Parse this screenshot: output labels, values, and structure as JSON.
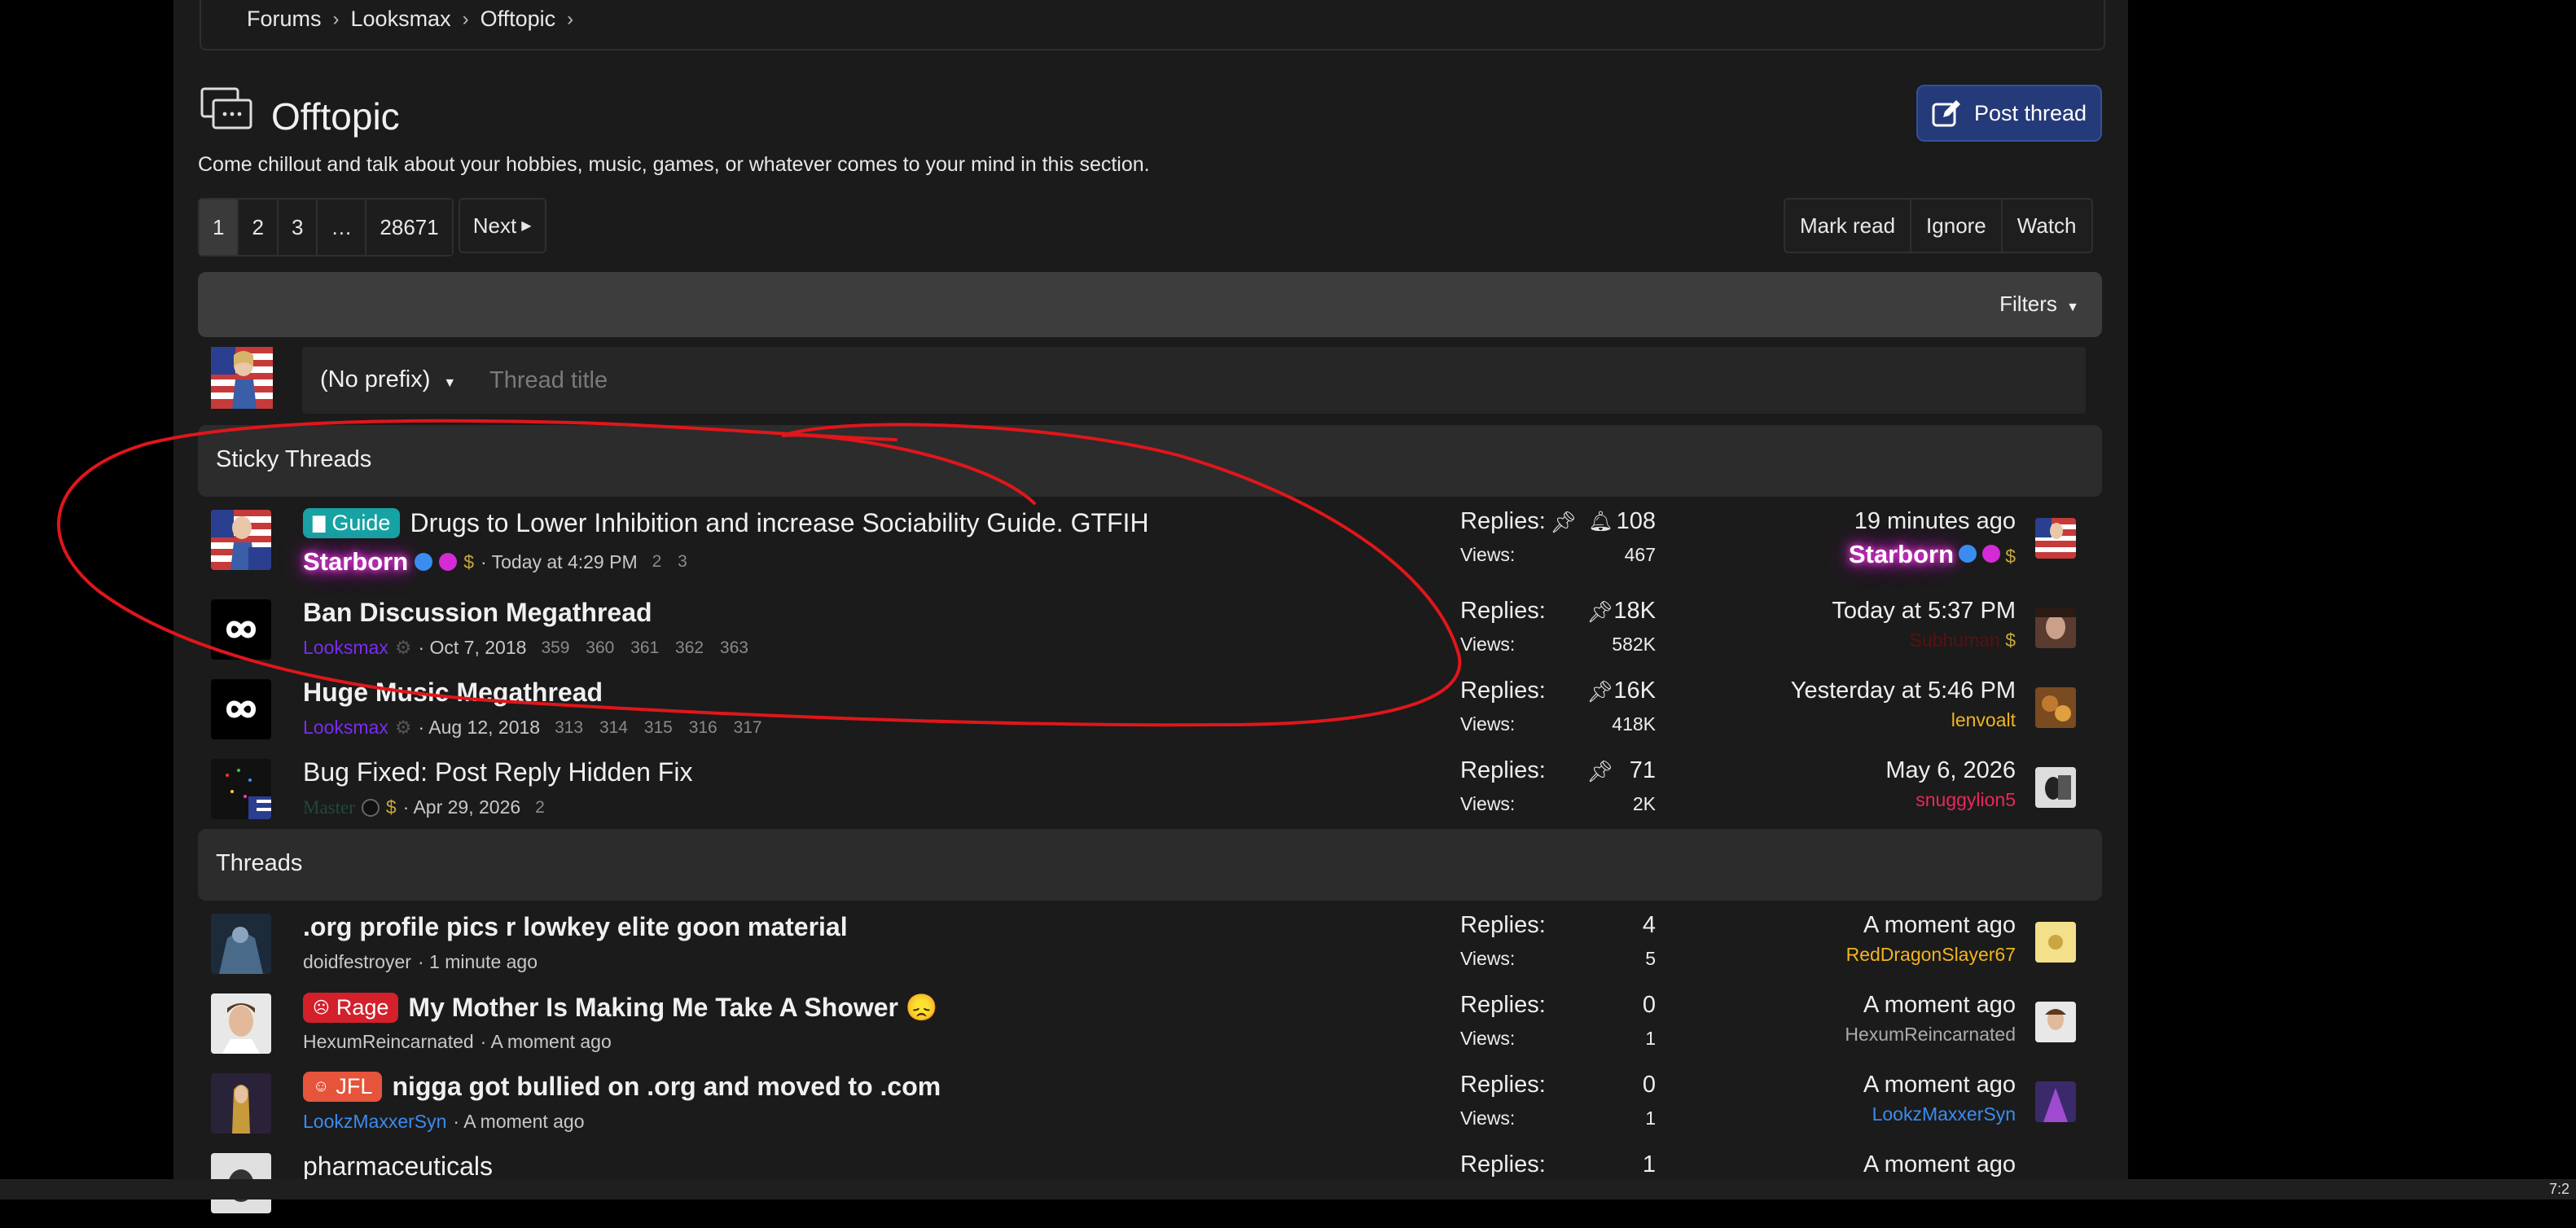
{
  "breadcrumb": [
    "Forums",
    "Looksmax",
    "Offtopic"
  ],
  "page": {
    "title": "Offtopic",
    "description": "Come chillout and talk about your hobbies, music, games, or whatever comes to your mind in this section.",
    "post_button": "Post thread"
  },
  "pagination": {
    "pages": [
      "1",
      "2",
      "3",
      "…",
      "28671"
    ],
    "current": "1",
    "next": "Next"
  },
  "actions": [
    "Mark read",
    "Ignore",
    "Watch"
  ],
  "filters_label": "Filters",
  "new_thread": {
    "prefix": "(No prefix)",
    "placeholder": "Thread title"
  },
  "sections": {
    "sticky": "Sticky Threads",
    "threads": "Threads"
  },
  "sticky_threads": [
    {
      "label": "Guide",
      "title": "Drugs to Lower Inhibition and increase Sociability Guide. GTFIH",
      "author": "Starborn",
      "date": "Today at 4:29 PM",
      "pages": "2 3",
      "replies": "108",
      "views": "467",
      "last_time": "19 minutes ago",
      "last_user": "Starborn"
    },
    {
      "title": "Ban Discussion Megathread",
      "author": "Looksmax",
      "date": "Oct 7, 2018",
      "pages": "359 360 361 362 363",
      "replies": "18K",
      "views": "582K",
      "last_time": "Today at 5:37 PM",
      "last_user": "Subhuman"
    },
    {
      "title": "Huge Music Megathread",
      "author": "Looksmax",
      "date": "Aug 12, 2018",
      "pages": "313 314 315 316 317",
      "replies": "16K",
      "views": "418K",
      "last_time": "Yesterday at 5:46 PM",
      "last_user": "lenvoalt"
    },
    {
      "title": "Bug Fixed: Post Reply Hidden Fix",
      "author": "Master",
      "date": "Apr 29, 2026",
      "pages": "2",
      "replies": "71",
      "views": "2K",
      "last_time": "May 6, 2026",
      "last_user": "snuggylion5"
    }
  ],
  "threads": [
    {
      "title": ".org profile pics r lowkey elite goon material",
      "author": "doidfestroyer",
      "date": "1 minute ago",
      "replies": "4",
      "views": "5",
      "last_time": "A moment ago",
      "last_user": "RedDragonSlayer67"
    },
    {
      "label": "Rage",
      "title": "My Mother Is Making Me Take A Shower 😞",
      "author": "HexumReincarnated",
      "date": "A moment ago",
      "replies": "0",
      "views": "1",
      "last_time": "A moment ago",
      "last_user": "HexumReincarnated"
    },
    {
      "label": "JFL",
      "title": "nigga got bullied on .org and moved to .com",
      "author": "LookzMaxxerSyn",
      "date": "A moment ago",
      "replies": "0",
      "views": "1",
      "last_time": "A moment ago",
      "last_user": "LookzMaxxerSyn"
    },
    {
      "title": "pharmaceuticals",
      "replies": "1",
      "last_time": "A moment ago"
    }
  ],
  "stat_labels": {
    "replies": "Replies:",
    "views": "Views:"
  },
  "taskbar": {
    "clock": "7:2"
  },
  "colors": {
    "page_bg": "#1b1b1b",
    "section_bg": "#2c2c2c",
    "filter_bg": "#3d3d3d",
    "post_button": "#253a78",
    "guide": "#17a2a3",
    "rage": "#d3202b",
    "jfl": "#e6543b",
    "looksmax_user": "#7b2cf0",
    "lenvoalt_user": "#f0b41e",
    "snuggylion_user": "#e8285a",
    "reddragon_user": "#f0b41e",
    "lookz_user": "#3b8cf0",
    "annotation": "#e0161b"
  }
}
